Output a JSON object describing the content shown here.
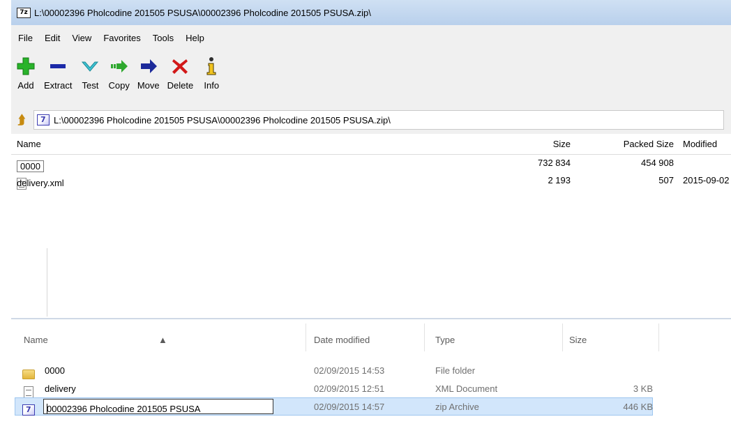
{
  "zip_window": {
    "logo": "7z",
    "title": "L:\\00002396 Pholcodine 201505 PSUSA\\00002396 Pholcodine 201505 PSUSA.zip\\",
    "menu": [
      "File",
      "Edit",
      "View",
      "Favorites",
      "Tools",
      "Help"
    ],
    "toolbar": [
      {
        "label": "Add",
        "icon": "add-icon",
        "color": "#1da81d"
      },
      {
        "label": "Extract",
        "icon": "extract-icon",
        "color": "#1c2aa8"
      },
      {
        "label": "Test",
        "icon": "test-icon",
        "color": "#31b7c9"
      },
      {
        "label": "Copy",
        "icon": "copy-icon",
        "color": "#1f9c1f"
      },
      {
        "label": "Move",
        "icon": "move-icon",
        "color": "#1c2a9a"
      },
      {
        "label": "Delete",
        "icon": "delete-icon",
        "color": "#d21818"
      },
      {
        "label": "Info",
        "icon": "info-icon",
        "color": "#9a7a10"
      }
    ],
    "address": "L:\\00002396 Pholcodine 201505 PSUSA\\00002396 Pholcodine 201505 PSUSA.zip\\",
    "columns": {
      "name": "Name",
      "size": "Size",
      "packed": "Packed Size",
      "modified": "Modified"
    },
    "rows": [
      {
        "name": "0000",
        "type": "folder",
        "size": "732 834",
        "packed": "454 908",
        "modified": ""
      },
      {
        "name": "delivery.xml",
        "type": "xml",
        "size": "2 193",
        "packed": "507",
        "modified": "2015-09-02"
      }
    ]
  },
  "explorer": {
    "columns": {
      "name": "Name",
      "date": "Date modified",
      "type": "Type",
      "size": "Size"
    },
    "rows": [
      {
        "name": "0000",
        "icon": "folder-icon",
        "date": "02/09/2015 14:53",
        "type": "File folder",
        "size": ""
      },
      {
        "name": "delivery",
        "icon": "xml-file-icon",
        "date": "02/09/2015 12:51",
        "type": "XML Document",
        "size": "3 KB"
      },
      {
        "name": "00002396 Pholcodine 201505 PSUSA",
        "icon": "zip-archive-icon",
        "date": "02/09/2015 14:57",
        "type": "zip Archive",
        "size": "446 KB",
        "selected": true
      }
    ]
  }
}
